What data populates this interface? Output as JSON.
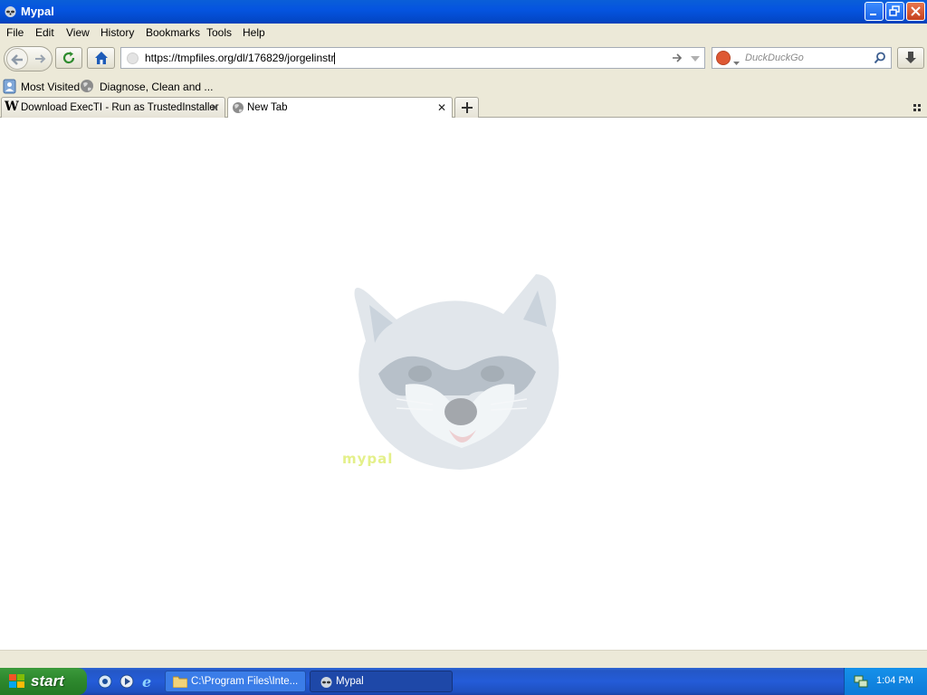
{
  "window": {
    "title": "Mypal"
  },
  "menu": [
    "File",
    "Edit",
    "View",
    "History",
    "Bookmarks",
    "Tools",
    "Help"
  ],
  "navigation": {
    "url": "https://tmpfiles.org/dl/176829/jorgelinstr",
    "search_placeholder": "DuckDuckGo"
  },
  "bookmarks": [
    {
      "label": "Most Visited",
      "icon": "bookmarks-icon"
    },
    {
      "label": "Diagnose, Clean and ...",
      "icon": "globe-icon"
    }
  ],
  "tabs": [
    {
      "label": "Download ExecTI - Run as TrustedInstaller",
      "icon": "w-favicon-icon",
      "active": false
    },
    {
      "label": "New Tab",
      "icon": "globe-icon",
      "active": true
    }
  ],
  "content": {
    "logo_text": "mypal"
  },
  "taskbar": {
    "start_label": "start",
    "tasks": [
      {
        "label": "C:\\Program Files\\Inte...",
        "icon": "folder-icon"
      },
      {
        "label": "Mypal",
        "icon": "mypal-icon"
      }
    ],
    "clock": "1:04 PM"
  },
  "colors": {
    "titlebar": "#0554e0",
    "taskbar": "#245cd8",
    "start": "#2f8a2f"
  }
}
